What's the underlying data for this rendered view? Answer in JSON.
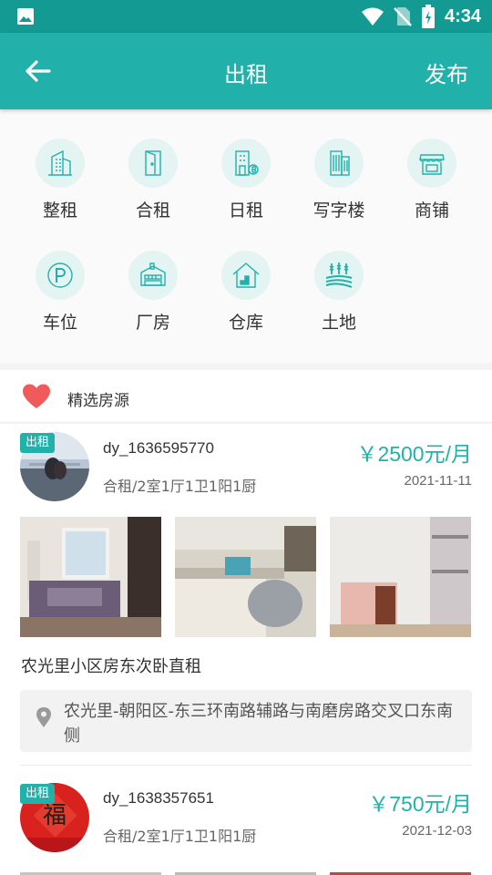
{
  "status_bar": {
    "time": "4:34",
    "icons": [
      "image-icon",
      "wifi-icon",
      "no-sim-icon",
      "battery-charging-icon"
    ]
  },
  "app_bar": {
    "title": "出租",
    "publish_label": "发布",
    "back_icon": "arrow-left-icon"
  },
  "categories": [
    {
      "label": "整租",
      "icon": "building-icon"
    },
    {
      "label": "合租",
      "icon": "door-icon"
    },
    {
      "label": "日租",
      "icon": "daily-building-icon"
    },
    {
      "label": "写字楼",
      "icon": "office-building-icon"
    },
    {
      "label": "商铺",
      "icon": "shop-icon"
    },
    {
      "label": "车位",
      "icon": "parking-icon"
    },
    {
      "label": "厂房",
      "icon": "factory-icon"
    },
    {
      "label": "仓库",
      "icon": "warehouse-icon"
    },
    {
      "label": "土地",
      "icon": "farmland-icon"
    }
  ],
  "section": {
    "title": "精选房源",
    "icon": "heart-icon"
  },
  "listings": [
    {
      "tag": "出租",
      "username": "dy_1636595770",
      "price": "￥2500元/月",
      "spec": "合租/2室1厅1卫1阳1厨",
      "date": "2021-11-11",
      "title": "农光里小区房东次卧直租",
      "address": "农光里-朝阳区-东三环南路辅路与南磨房路交叉口东南侧"
    },
    {
      "tag": "出租",
      "username": "dy_1638357651",
      "price": "￥750元/月",
      "spec": "合租/2室1厅1卫1阳1厨",
      "date": "2021-12-03"
    }
  ],
  "colors": {
    "status_bar": "#129a93",
    "primary": "#22b1aa",
    "icon_bg": "#e4f4f3",
    "heart": "#f05a5a"
  }
}
